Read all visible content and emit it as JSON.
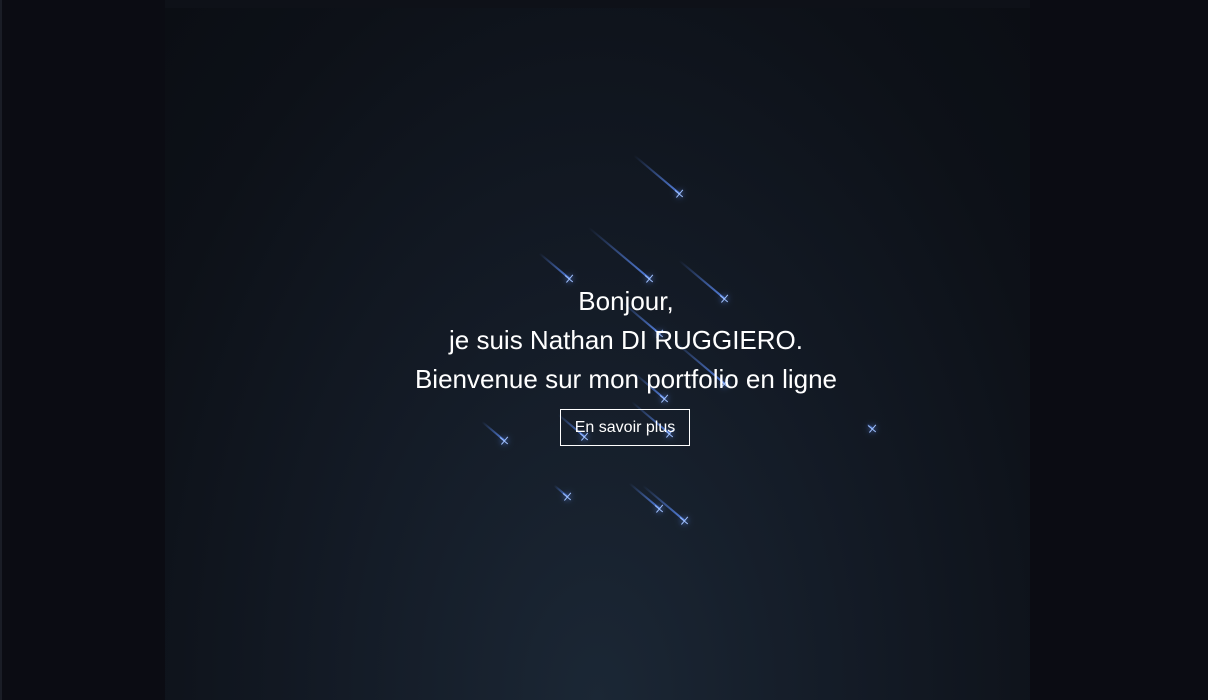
{
  "hero": {
    "greeting": "Bonjour,",
    "intro": "je suis Nathan DI RUGGIERO.",
    "welcome": "Bienvenue sur mon portfolio en ligne"
  },
  "cta": {
    "label": "En savoir plus"
  },
  "theme": {
    "background": "#0b0d14",
    "meteor_color": "#5f91ff",
    "text_color": "#ffffff"
  }
}
